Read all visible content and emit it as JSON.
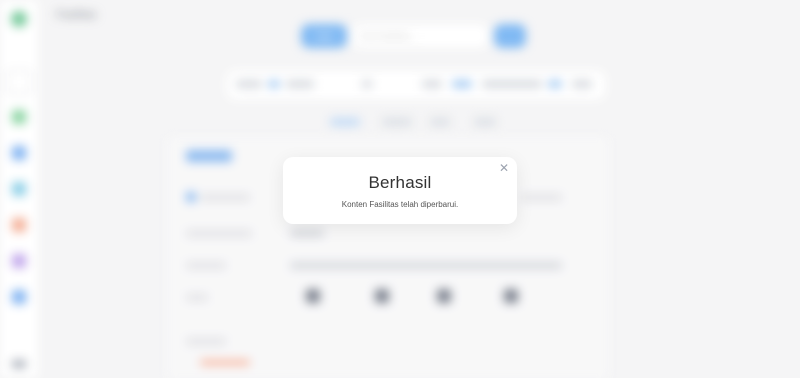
{
  "page": {
    "title": "Fasilitas"
  },
  "toolbar": {
    "left_button_label": "Cari",
    "search_placeholder": "Cari fasilitas..."
  },
  "modal": {
    "title": "Berhasil",
    "message": "Konten Fasilitas telah diperbarui.",
    "close_icon": "close-icon"
  },
  "colors": {
    "accent": "#6fb0f2",
    "sidebar_green": "#62c28c",
    "overlay": "#ffffff"
  }
}
